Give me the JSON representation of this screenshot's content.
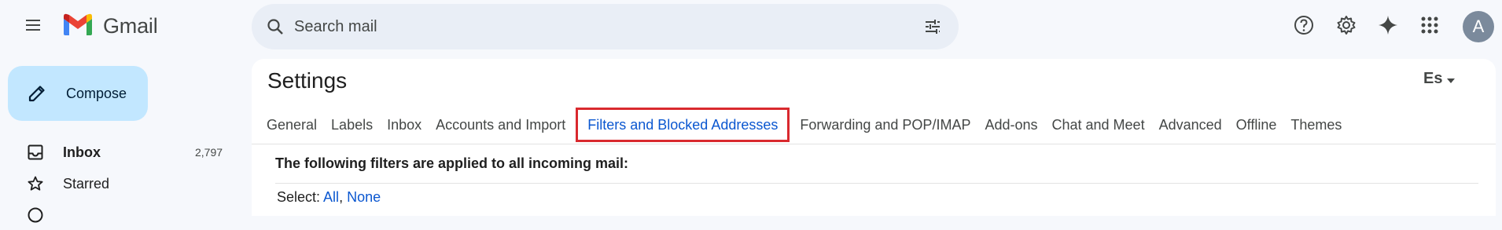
{
  "header": {
    "app_name": "Gmail",
    "search_placeholder": "Search mail",
    "avatar_initial": "A",
    "icons": [
      "menu-icon",
      "gmail-logo",
      "search-icon",
      "tune-icon",
      "help-icon",
      "settings-icon",
      "gemini-sparkle-icon",
      "apps-grid-icon"
    ]
  },
  "sidebar": {
    "compose_label": "Compose",
    "items": [
      {
        "label": "Inbox",
        "count": "2,797",
        "icon": "inbox-icon"
      },
      {
        "label": "Starred",
        "count": "",
        "icon": "star-icon"
      }
    ]
  },
  "settings": {
    "title": "Settings",
    "language_indicator": "Es",
    "tabs": [
      {
        "label": "General"
      },
      {
        "label": "Labels"
      },
      {
        "label": "Inbox"
      },
      {
        "label": "Accounts and Import"
      },
      {
        "label": "Filters and Blocked Addresses",
        "active": true
      },
      {
        "label": "Forwarding and POP/IMAP"
      },
      {
        "label": "Add-ons"
      },
      {
        "label": "Chat and Meet"
      },
      {
        "label": "Advanced"
      },
      {
        "label": "Offline"
      },
      {
        "label": "Themes"
      }
    ],
    "filters_heading": "The following filters are applied to all incoming mail:",
    "select_label": "Select:",
    "select_all": "All",
    "select_separator": ",",
    "select_none": "None"
  },
  "colors": {
    "accent": "#0b57d0",
    "compose_bg": "#c2e7ff",
    "highlight_border": "#d9292e",
    "search_bg": "#e9eef6",
    "page_bg": "#f6f8fc"
  }
}
